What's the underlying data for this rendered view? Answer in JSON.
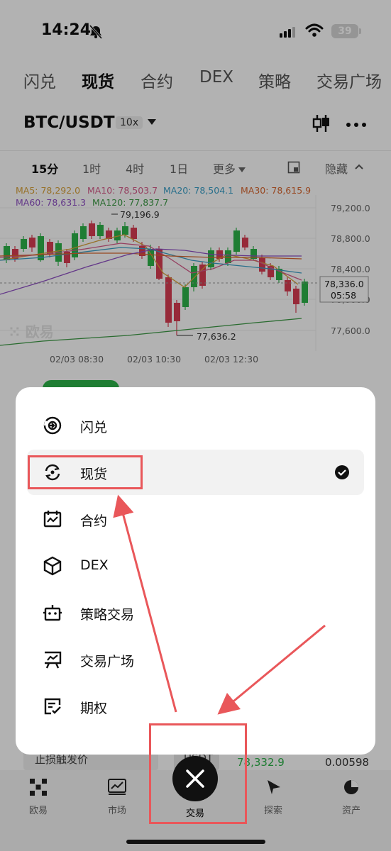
{
  "status_bar": {
    "time": "14:24",
    "battery": "39"
  },
  "top_tabs": [
    "闪兑",
    "现货",
    "合约",
    "DEX",
    "策略",
    "交易广场"
  ],
  "active_tab": "现货",
  "pair": {
    "symbol": "BTC/USDT",
    "leverage": "10x"
  },
  "intervals": {
    "items": [
      "15分",
      "1时",
      "4时",
      "1日",
      "更多"
    ],
    "hide": "隐藏"
  },
  "chart_data": {
    "type": "candlestick",
    "ma_legend": [
      {
        "label": "MA5: 78,292.0",
        "color": "#d9a23a"
      },
      {
        "label": "MA10: 78,503.7",
        "color": "#d65b8a"
      },
      {
        "label": "MA20: 78,504.1",
        "color": "#3aa0c8"
      },
      {
        "label": "MA30: 78,615.9",
        "color": "#d8662e"
      },
      {
        "label": "MA60: 78,631.3",
        "color": "#8f4fc4"
      },
      {
        "label": "MA120: 77,837.7",
        "color": "#3c9a44"
      }
    ],
    "y_ticks": [
      "79,200.0",
      "78,800.0",
      "78,400.0",
      "78,000.0",
      "77,600.0"
    ],
    "x_ticks": [
      "02/03 08:30",
      "02/03 10:30",
      "02/03 12:30"
    ],
    "high_label": "79,196.9",
    "low_label": "77,636.2",
    "current_price": "78,336.0",
    "countdown": "05:58",
    "watermark": "欧易",
    "colors": {
      "up": "#2db34a",
      "down": "#d93d52"
    }
  },
  "menu": {
    "items": [
      {
        "label": "闪兑",
        "icon": "flash-swap-icon",
        "selected": false
      },
      {
        "label": "现货",
        "icon": "spot-icon",
        "selected": true
      },
      {
        "label": "合约",
        "icon": "futures-icon",
        "selected": false
      },
      {
        "label": "DEX",
        "icon": "dex-cube-icon",
        "selected": false
      },
      {
        "label": "策略交易",
        "icon": "robot-icon",
        "selected": false
      },
      {
        "label": "交易广场",
        "icon": "trading-square-icon",
        "selected": false
      },
      {
        "label": "期权",
        "icon": "options-icon",
        "selected": false
      }
    ]
  },
  "background_row": {
    "label": "止损触发价",
    "unit": "USDT",
    "price": "78,332.9",
    "amount": "0.00598"
  },
  "bottom_nav": [
    {
      "label": "欧易",
      "icon": "okx-logo-icon"
    },
    {
      "label": "市场",
      "icon": "market-chart-icon"
    },
    {
      "label": "交易",
      "icon": "close-icon"
    },
    {
      "label": "探索",
      "icon": "compass-icon"
    },
    {
      "label": "资产",
      "icon": "pie-chart-icon"
    }
  ]
}
